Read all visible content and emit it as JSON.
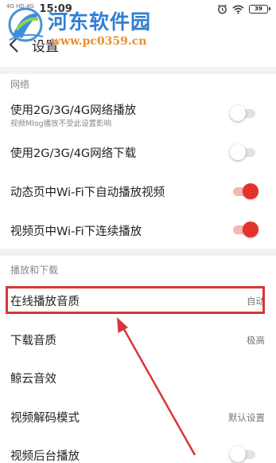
{
  "status_bar": {
    "signal": "4G HD 4G",
    "time": "15:09",
    "battery": "39"
  },
  "header": {
    "title": "设置"
  },
  "watermark": {
    "site_name": "河东软件园",
    "url": "www.pc0359.cn"
  },
  "sections": {
    "network": {
      "title": "网络",
      "items": [
        {
          "label": "使用2G/3G/4G网络播放",
          "sub": "视频Mlog播放不受此设置影响",
          "toggle": "off"
        },
        {
          "label": "使用2G/3G/4G网络下载",
          "toggle": "off"
        },
        {
          "label": "动态页中Wi-Fi下自动播放视频",
          "toggle": "on"
        },
        {
          "label": "视频页中Wi-Fi下连续播放",
          "toggle": "on"
        }
      ]
    },
    "playback": {
      "title": "播放和下载",
      "items": [
        {
          "label": "在线播放音质",
          "value": "自动"
        },
        {
          "label": "下载音质",
          "value": "极高"
        },
        {
          "label": "鲸云音效"
        },
        {
          "label": "视频解码模式",
          "value": "默认设置"
        },
        {
          "label": "视频后台播放",
          "toggle": "off"
        }
      ]
    }
  },
  "colors": {
    "accent": "#e4322b",
    "highlight": "#d8353a",
    "watermark_blue": "#2f7fd4",
    "watermark_orange": "#e8902c"
  }
}
